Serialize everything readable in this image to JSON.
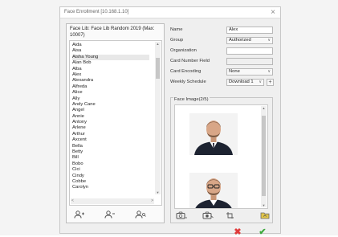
{
  "window": {
    "title": "Face Enrollment [10.168.1.10]",
    "close_glyph": "×"
  },
  "list": {
    "title": "Face Lib: Face Lib Random 2019 (Max: 10007)",
    "items": [
      "Aida",
      "Aisa",
      "Aisha Young",
      "Alan Bob",
      "Alba",
      "Alex",
      "Alexandra",
      "Alfreda",
      "Alice",
      "Ally",
      "Andy Cane",
      "Angel",
      "Annie",
      "Antony",
      "Arlene",
      "Arthur",
      "Axcent",
      "Bella",
      "Betty",
      "Bill",
      "Bobo",
      "Cici",
      "Cindy",
      "Cobbe",
      "Carolyn"
    ],
    "scroll_up": "▲",
    "scroll_down": "▼",
    "scroll_left": "<",
    "scroll_right": ">",
    "icons": [
      "add-user-icon",
      "delete-user-icon",
      "search-user-icon"
    ]
  },
  "form": {
    "name_label": "Name",
    "name_value": "Alex",
    "group_label": "Group",
    "group_value": "Authorized",
    "org_label": "Organization",
    "org_value": "",
    "card_label": "Card Number Field",
    "card_value": "",
    "card_encoding_label": "Card Encoding",
    "card_encoding_value": "None",
    "weekly_label": "Weekly Schedule",
    "weekly_value": "Download 1",
    "plus_glyph": "+",
    "face_label": "Face Image(2/5)",
    "caret": "∨"
  },
  "face": {
    "icons": [
      "camera-add-icon",
      "camera-capture-icon",
      "crop-icon",
      "folder-icon"
    ]
  },
  "actions": {
    "cancel_glyph": "✖",
    "ok_glyph": "✔",
    "cancel_color": "#e03a3a",
    "ok_color": "#3aa83a"
  }
}
